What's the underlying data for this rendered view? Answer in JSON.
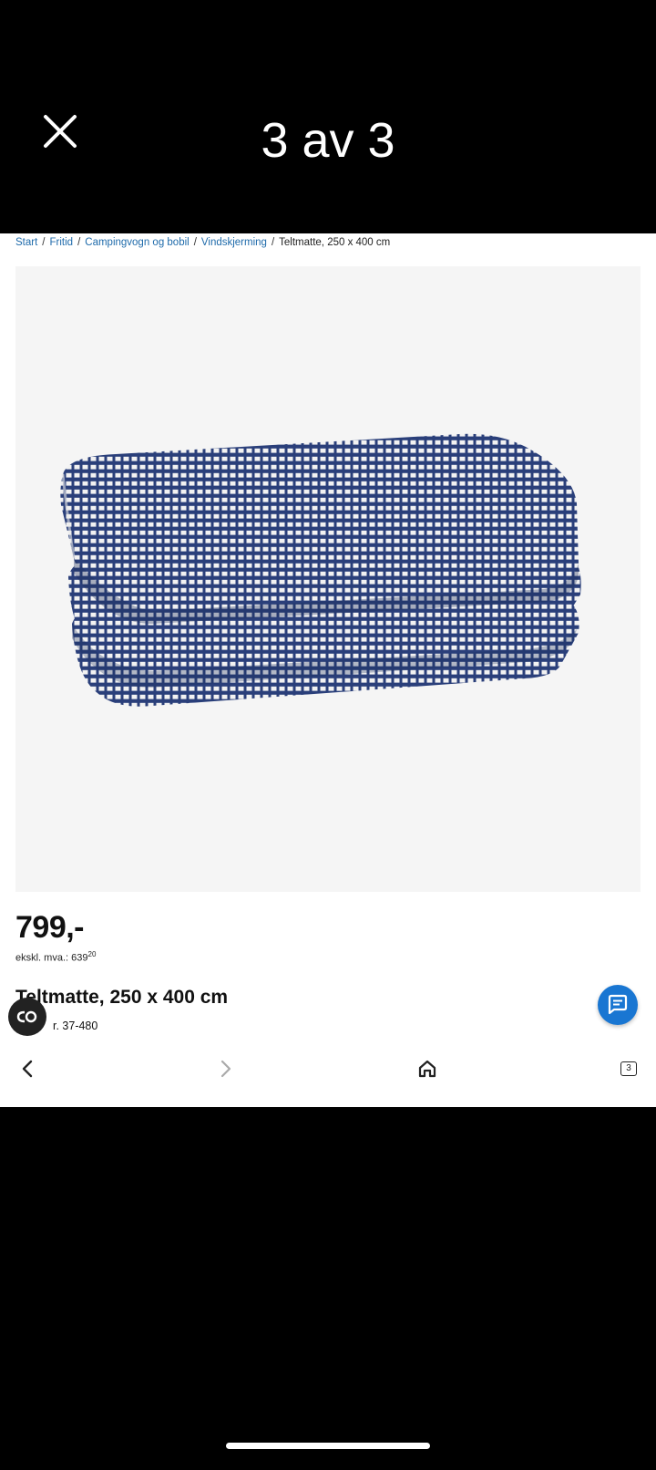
{
  "viewer": {
    "counter": "3 av 3"
  },
  "breadcrumb": {
    "items": [
      "Start",
      "Fritid",
      "Campingvogn og bobil",
      "Vindskjerming"
    ],
    "separator": "/",
    "current": "Teltmatte, 250 x 400 cm"
  },
  "product": {
    "price": "799,-",
    "ex_vat_label": "ekskl. mva.:",
    "ex_vat_value": "639",
    "ex_vat_cents": "20",
    "title": "Teltmatte, 250 x 400 cm",
    "art_no": "r. 37-480"
  },
  "bottom_nav": {
    "tabs_count": "3"
  },
  "icons": {
    "close": "close-icon",
    "chat": "chat-icon",
    "lens": "lens-icon",
    "back": "chevron-left-icon",
    "forward": "chevron-right-icon",
    "home": "home-icon",
    "tabs": "tabs-icon"
  },
  "colors": {
    "link": "#1f6bab",
    "chat_button": "#1976d2",
    "mat_blue": "#2a3f7a"
  }
}
